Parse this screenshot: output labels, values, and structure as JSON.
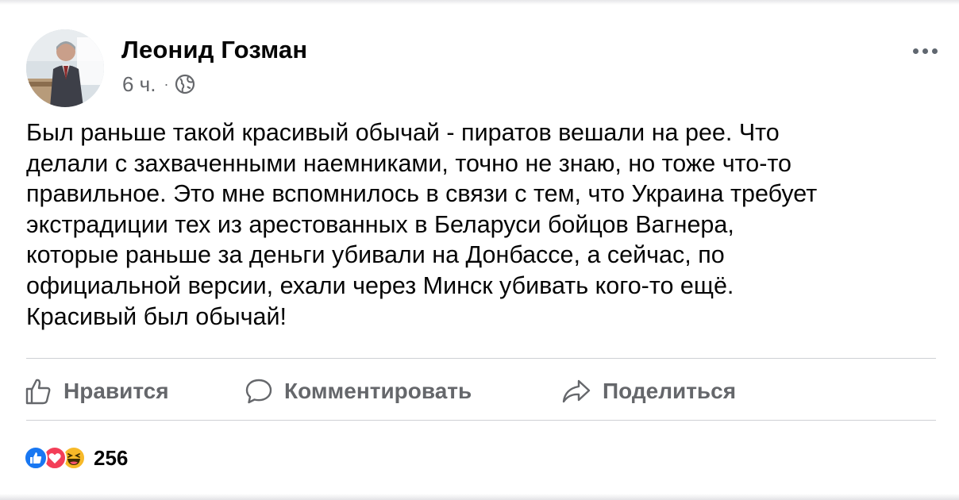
{
  "post": {
    "author": "Леонид Гозман",
    "time": "6 ч.",
    "separator": "·",
    "privacy_icon": "globe-icon",
    "text_lines": [
      "Был раньше такой красивый обычай - пиратов вешали на рее. Что",
      "делали с захваченными наемниками, точно не знаю, но тоже что-то",
      "правильное. Это мне вспомнилось в связи с тем, что Украина требует",
      "экстрадиции тех из арестованных в Беларуси бойцов Вагнера,",
      "которые раньше за деньги убивали на Донбассе, а сейчас, по",
      "официальной версии, ехали через Минск убивать кого-то ещё.",
      "Красивый был обычай!"
    ]
  },
  "actions": {
    "like_label": "Нравится",
    "comment_label": "Комментировать",
    "share_label": "Поделиться"
  },
  "reactions": {
    "icons": [
      "like-icon",
      "love-icon",
      "haha-icon"
    ],
    "count": "256"
  },
  "colors": {
    "text": "#050505",
    "secondary": "#65676b",
    "divider": "#ced0d4",
    "like_blue": "#1877f2",
    "love_red": "#f33e58",
    "haha_yellow": "#f7b928"
  }
}
